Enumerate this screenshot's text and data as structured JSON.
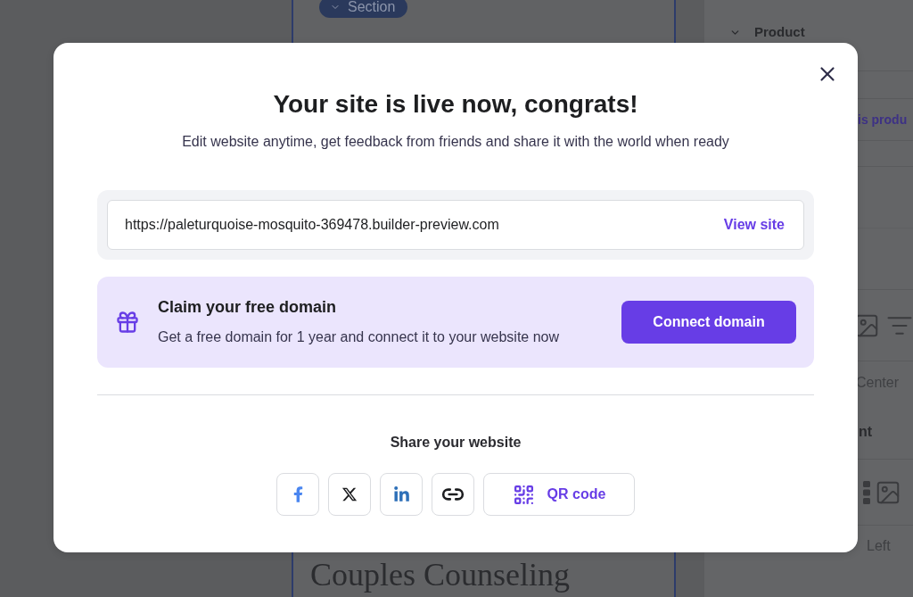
{
  "editor": {
    "canvas": {
      "section_label": "Section",
      "heading": "Couples Counseling"
    },
    "settings_panel": {
      "group_title": "Product",
      "link_text": "is produ",
      "alignment_value": "Center",
      "section_title": "nt",
      "position_value": "Left"
    }
  },
  "dialog": {
    "title": "Your site is live now, congrats!",
    "subtitle": "Edit website anytime, get feedback from friends and share it with the world when ready",
    "site_url": "https://paleturquoise-mosquito-369478.builder-preview.com",
    "view_link": "View site",
    "promo": {
      "title": "Claim your free domain",
      "description": "Get a free domain for 1 year and connect it to your website now",
      "button": "Connect domain"
    },
    "share": {
      "title": "Share your website",
      "buttons": [
        {
          "kind": "facebook"
        },
        {
          "kind": "x"
        },
        {
          "kind": "linkedin"
        },
        {
          "kind": "link"
        },
        {
          "kind": "qr",
          "label": "QR code"
        }
      ]
    }
  }
}
